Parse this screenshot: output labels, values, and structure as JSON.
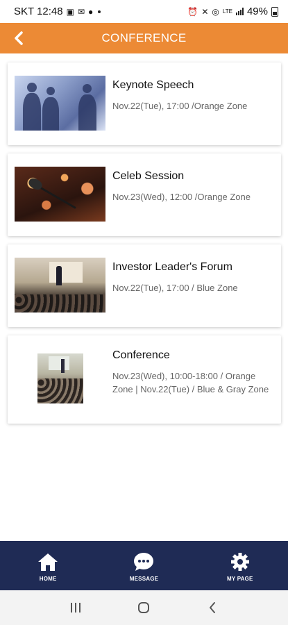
{
  "status_bar": {
    "carrier_time": "SKT 12:48",
    "battery_percent": "49%"
  },
  "header": {
    "title": "CONFERENCE",
    "accent_color": "#ec8a35"
  },
  "sessions": [
    {
      "title": "Keynote Speech",
      "meta": "Nov.22(Tue), 17:00 /Orange Zone",
      "image": "handshake-business-photo"
    },
    {
      "title": "Celeb Session",
      "meta": "Nov.23(Wed), 12:00 /Orange Zone",
      "image": "microphone-stage-photo"
    },
    {
      "title": "Investor Leader's Forum",
      "meta": "Nov.22(Tue), 17:00 / Blue Zone",
      "image": "speaker-audience-photo"
    },
    {
      "title": "Conference",
      "meta": "Nov.23(Wed), 10:00-18:00 / Orange Zone | Nov.22(Tue) / Blue & Gray Zone",
      "image": "conference-room-photo"
    }
  ],
  "bottom_nav": {
    "background_color": "#1f2b55",
    "items": [
      {
        "label": "HOME",
        "icon": "home-icon"
      },
      {
        "label": "MESSAGE",
        "icon": "chat-bubble-icon"
      },
      {
        "label": "MY PAGE",
        "icon": "gear-icon"
      }
    ]
  },
  "system_nav": {
    "items": [
      "recent-apps-icon",
      "home-circle-icon",
      "back-chevron-icon"
    ]
  }
}
